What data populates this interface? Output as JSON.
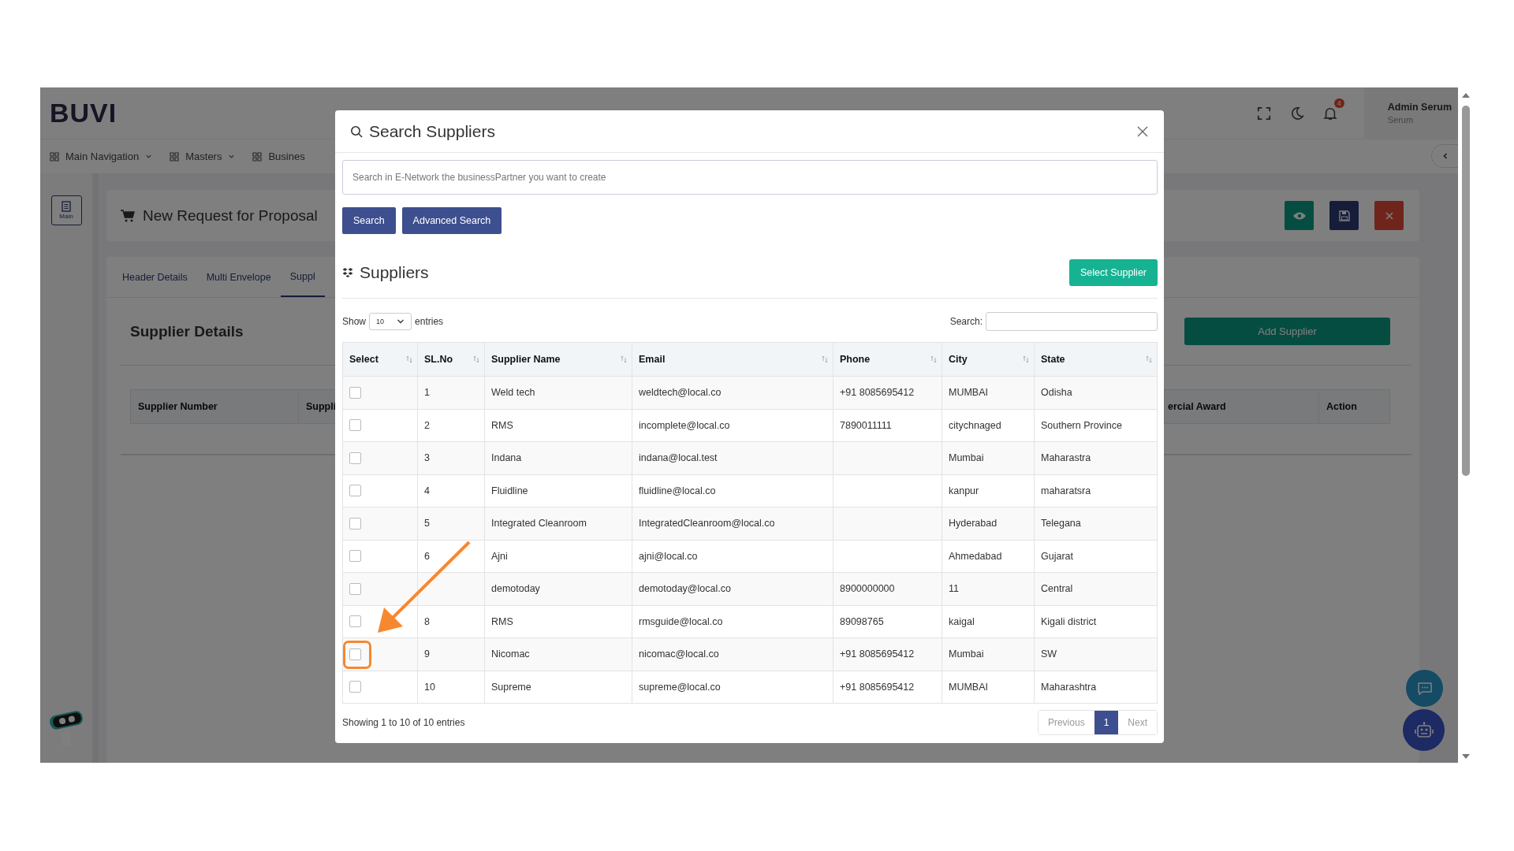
{
  "header": {
    "logo": "BUVI",
    "notification_count": "4",
    "user_name": "Admin Serum",
    "user_role": "Serum"
  },
  "nav": [
    {
      "label": "Main Navigation",
      "has_menu": true
    },
    {
      "label": "Masters",
      "has_menu": true
    },
    {
      "label": "Busines",
      "has_menu": false
    }
  ],
  "sidebar": {
    "button_label": "Main"
  },
  "page": {
    "title": "New Request for Proposal"
  },
  "tabs": [
    {
      "label": "Header Details",
      "selected": false
    },
    {
      "label": "Multi Envelope",
      "selected": false
    },
    {
      "label": "Suppl",
      "selected": true
    }
  ],
  "section": {
    "title": "Supplier Details",
    "add_button": "Add Supplier",
    "columns": [
      "Supplier Number",
      "Suppli",
      "ercial Award",
      "Action"
    ]
  },
  "modal": {
    "title": "Search Suppliers",
    "search_placeholder": "Search in E-Network the businessPartner you want to create",
    "buttons": [
      "Search",
      "Advanced Search"
    ],
    "section_title": "Suppliers",
    "select_button": "Select Supplier",
    "show_label": "Show",
    "page_size": "10",
    "entries_label": "entries",
    "search_label": "Search:",
    "columns": [
      "Select",
      "SL.No",
      "Supplier Name",
      "Email",
      "Phone",
      "City",
      "State"
    ],
    "rows": [
      {
        "checked": false,
        "highlighted": false,
        "sl": "1",
        "name": "Weld tech",
        "email": "weldtech@local.co",
        "phone": "+91 8085695412",
        "city": "MUMBAI",
        "state": "Odisha"
      },
      {
        "checked": false,
        "highlighted": false,
        "sl": "2",
        "name": "RMS",
        "email": "incomplete@local.co",
        "phone": "7890011111",
        "city": "citychnaged",
        "state": "Southern Province"
      },
      {
        "checked": false,
        "highlighted": false,
        "sl": "3",
        "name": "Indana",
        "email": "indana@local.test",
        "city": "Mumbai",
        "state": "Maharastra"
      },
      {
        "checked": false,
        "highlighted": false,
        "sl": "4",
        "name": "Fluidline",
        "email": "fluidline@local.co",
        "city": "kanpur",
        "state": "maharatsra"
      },
      {
        "checked": false,
        "highlighted": false,
        "sl": "5",
        "name": "Integrated Cleanroom",
        "email": "IntegratedCleanroom@local.co",
        "city": "Hyderabad",
        "state": "Telegana"
      },
      {
        "checked": false,
        "highlighted": false,
        "sl": "6",
        "name": "Ajni",
        "email": "ajni@local.co",
        "city": "Ahmedabad",
        "state": "Gujarat"
      },
      {
        "checked": false,
        "highlighted": false,
        "name": "demotoday",
        "email": "demotoday@local.co",
        "phone": "8900000000",
        "city": "11",
        "state": "Central"
      },
      {
        "checked": false,
        "highlighted": false,
        "sl": "8",
        "name": "RMS",
        "email": "rmsguide@local.co",
        "phone": "89098765",
        "city": "kaigal",
        "state": "Kigali district"
      },
      {
        "checked": false,
        "highlighted": true,
        "sl": "9",
        "name": "Nicomac",
        "email": "nicomac@local.co",
        "phone": "+91 8085695412",
        "city": "Mumbai",
        "state": "SW"
      },
      {
        "checked": false,
        "highlighted": false,
        "sl": "10",
        "name": "Supreme",
        "email": "supreme@local.co",
        "phone": "+91 8085695412",
        "city": "MUMBAI",
        "state": "Maharashtra"
      }
    ],
    "info": "Showing 1 to 10 of 10 entries",
    "pagination": [
      {
        "label": "Previous",
        "selected": false,
        "disabled": true
      },
      {
        "label": "1",
        "selected": true,
        "disabled": false
      },
      {
        "label": "Next",
        "selected": false,
        "disabled": true
      }
    ]
  }
}
